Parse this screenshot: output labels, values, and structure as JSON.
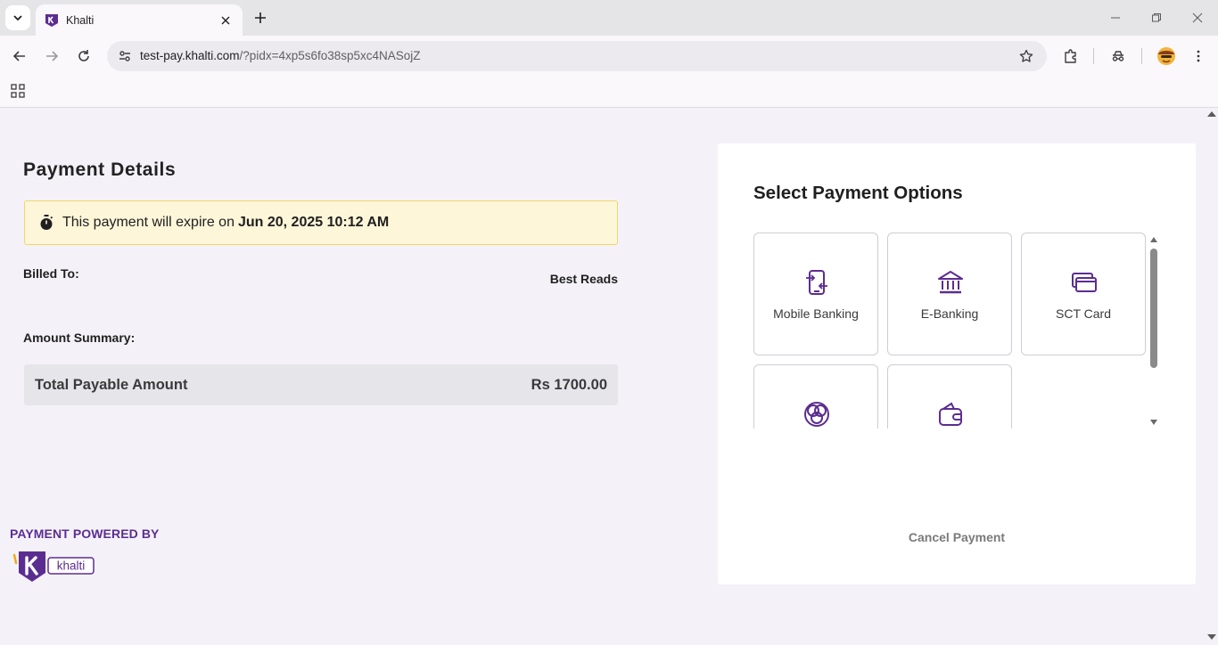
{
  "browser": {
    "tab": {
      "title": "Khalti"
    },
    "url": {
      "host": "test-pay.khalti.com",
      "path": "/?pidx=4xp5s6fo38sp5xc4NASojZ"
    }
  },
  "page": {
    "title": "Payment Details",
    "expiry": {
      "prefix": "This payment will expire on",
      "datetime": "Jun 20, 2025 10:12 AM"
    },
    "billed_to": {
      "label": "Billed To:",
      "value": "Best Reads"
    },
    "amount_summary": {
      "label": "Amount Summary:"
    },
    "total": {
      "label": "Total Payable Amount",
      "value": "Rs 1700.00"
    },
    "powered_by": "PAYMENT POWERED BY",
    "logo_text": "khalti"
  },
  "payment_options": {
    "title": "Select Payment Options",
    "options": [
      {
        "label": "Mobile Banking",
        "icon": "mobile-banking-icon"
      },
      {
        "label": "E-Banking",
        "icon": "bank-icon"
      },
      {
        "label": "SCT Card",
        "icon": "card-icon"
      },
      {
        "label": "",
        "icon": "connect-ips-icon"
      },
      {
        "label": "",
        "icon": "wallet-icon"
      }
    ],
    "cancel_label": "Cancel Payment"
  },
  "colors": {
    "brand": "#5c2d91",
    "expiry_bg": "#fdf6d9",
    "expiry_border": "#f0d66a"
  }
}
